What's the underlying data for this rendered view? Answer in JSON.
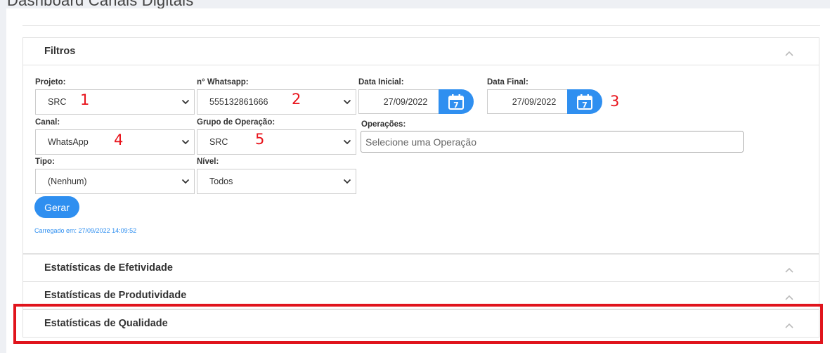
{
  "page": {
    "title": "Dashboard Canais Digitais"
  },
  "filters": {
    "title": "Filtros",
    "projeto": {
      "label": "Projeto:",
      "value": "SRC"
    },
    "whatsapp": {
      "label": "n° Whatsapp:",
      "value": "555132861666"
    },
    "data_inicial": {
      "label": "Data Inicial:",
      "value": "27/09/2022",
      "icon_day": "7"
    },
    "data_final": {
      "label": "Data Final:",
      "value": "27/09/2022",
      "icon_day": "7"
    },
    "canal": {
      "label": "Canal:",
      "value": "WhatsApp"
    },
    "grupo": {
      "label": "Grupo de Operação:",
      "value": "SRC"
    },
    "operacoes": {
      "label": "Operações:",
      "placeholder": "Selecione uma Operação"
    },
    "tipo": {
      "label": "Tipo:",
      "value": "(Nenhum)"
    },
    "nivel": {
      "label": "Nível:",
      "value": "Todos"
    },
    "gerar_label": "Gerar",
    "loaded_text": "Carregado em: 27/09/2022 14:09:52"
  },
  "sections": {
    "efetividade": "Estatísticas de Efetividade",
    "produtividade": "Estatísticas de Produtividade",
    "qualidade": "Estatísticas de Qualidade"
  },
  "annotations": [
    "1",
    "2",
    "3",
    "4",
    "5"
  ],
  "colors": {
    "accent": "#2f8ff0",
    "annotation": "#e8141c"
  }
}
